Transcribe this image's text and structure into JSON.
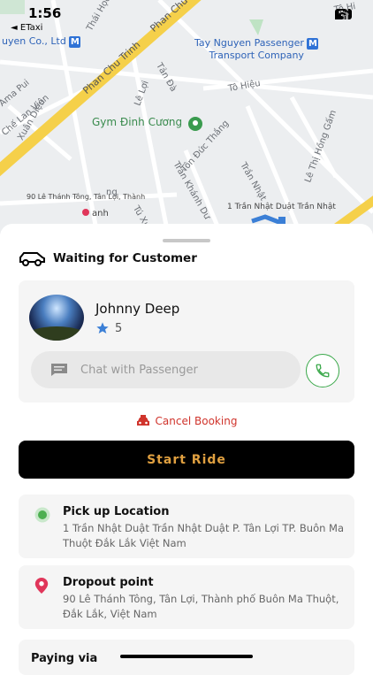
{
  "status_bar": {
    "time": "1:56",
    "back_app": "◄ ETaxi",
    "battery": "83"
  },
  "map": {
    "labels": {
      "thai_hoc": "Thái Học",
      "company_left": "uyen Co., Ltd",
      "phan_chu_trinh_1": "Phan Chu Trinh",
      "phan_chu_trinh_2": "Phan Chu",
      "tay_nguyen_1": "Tay Nguyen Passenger",
      "tay_nguyen_2": "Transport Company",
      "tan_da": "Tản Đà",
      "le_loi": "Lê Lợi",
      "to_hieu": "Tô Hiệu",
      "to_hieu_top": "Tô Hi",
      "ama_pui": "Ama Pui",
      "che_lan_vien": "Chế Lan Viên",
      "xuan_dieu": "Xuân Diệu",
      "gym": "Gym Đinh Cương",
      "ton_duc_thang": "Tôn Đức Thắng",
      "le_thi_hong_gam": "Lê Thị Hồng Gấm",
      "tran_nhat": "Trần Nhật",
      "tran_khanh_du": "Trần Khánh Dư",
      "tu_xu": "Tú Xư",
      "addr_bottom": "90 Lê Thánh Tông, Tân Lợi, Thành",
      "addr_right": "1 Trần Nhật Duật Trần Nhật",
      "anh": "anh",
      "ng": "ng"
    }
  },
  "sheet": {
    "status_title": "Waiting for Customer",
    "passenger": {
      "name": "Johnny Deep",
      "rating": "5",
      "chat_placeholder": "Chat with Passenger"
    },
    "cancel_label": "Cancel Booking",
    "start_label": "Start Ride",
    "pickup": {
      "title": "Pick up Location",
      "address": "1 Trần Nhật Duật Trần Nhật Duật P. Tân Lợi TP. Buôn Ma Thuột Đắk Lắk Việt Nam"
    },
    "dropout": {
      "title": "Dropout point",
      "address": "90 Lê Thánh Tông, Tân Lợi, Thành phố Buôn Ma Thuột, Đắk Lắk, Việt Nam"
    },
    "paying_label": "Paying via"
  },
  "colors": {
    "accent_orange": "#e0a040",
    "cancel_red": "#d0342c",
    "call_green": "#3aa84a",
    "pickup_green": "#4caf50",
    "dropout_pink": "#e0365a",
    "road_yellow": "#f5d04a",
    "star_blue": "#3b7fd6"
  },
  "icons": {
    "car": "car-icon",
    "star": "star-icon",
    "chat": "chat-icon",
    "phone": "phone-icon",
    "cancel": "taxi-cancel-icon",
    "pickup": "pickup-dot-icon",
    "dropout": "map-pin-icon"
  }
}
